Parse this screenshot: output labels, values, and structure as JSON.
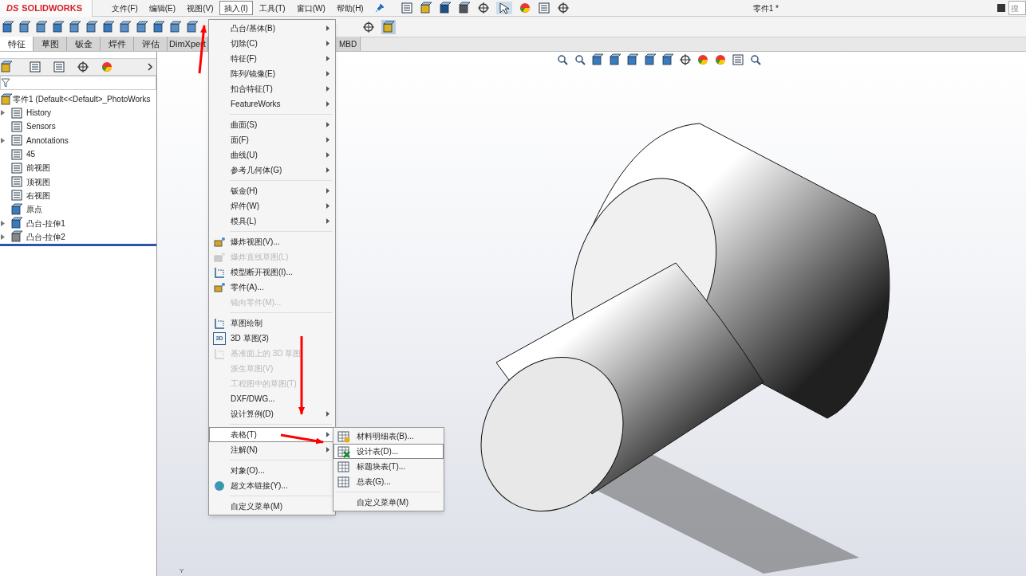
{
  "app": {
    "logo_text": "SOLIDWORKS",
    "logo_prefix": "DS"
  },
  "menu_bar": [
    {
      "label": "文件(F)",
      "selected": false
    },
    {
      "label": "编辑(E)",
      "selected": false
    },
    {
      "label": "视图(V)",
      "selected": false
    },
    {
      "label": "插入(I)",
      "selected": true
    },
    {
      "label": "工具(T)",
      "selected": false
    },
    {
      "label": "窗口(W)",
      "selected": false
    },
    {
      "label": "帮助(H)",
      "selected": false
    }
  ],
  "document_title": "零件1 *",
  "search": {
    "placeholder": "搜"
  },
  "command_tabs": [
    {
      "label": "特征",
      "selected": true
    },
    {
      "label": "草图",
      "selected": false
    },
    {
      "label": "钣金",
      "selected": false
    },
    {
      "label": "焊件",
      "selected": false
    },
    {
      "label": "评估",
      "selected": false
    },
    {
      "label": "DimXpert",
      "selected": false
    }
  ],
  "command_tab_tail": {
    "label": "MBD",
    "selected": false
  },
  "feature_tree": {
    "root": "零件1  (Default<<Default>_PhotoWorks",
    "items": [
      {
        "label": "History",
        "expandable": true
      },
      {
        "label": "Sensors",
        "expandable": false
      },
      {
        "label": "Annotations",
        "expandable": true
      },
      {
        "label": "45",
        "expandable": false
      },
      {
        "label": "前视图",
        "expandable": false
      },
      {
        "label": "顶视图",
        "expandable": false
      },
      {
        "label": "右视图",
        "expandable": false
      },
      {
        "label": "原点",
        "expandable": false
      },
      {
        "label": "凸台-拉伸1",
        "expandable": true
      },
      {
        "label": "凸台-拉伸2",
        "expandable": true
      }
    ]
  },
  "insert_menu": [
    {
      "kind": "item",
      "label": "凸台/基体(B)",
      "submenu": true,
      "disabled": false,
      "selected": false
    },
    {
      "kind": "item",
      "label": "切除(C)",
      "submenu": true,
      "disabled": false,
      "selected": false
    },
    {
      "kind": "item",
      "label": "特征(F)",
      "submenu": true,
      "disabled": false,
      "selected": false
    },
    {
      "kind": "item",
      "label": "阵列/镜像(E)",
      "submenu": true,
      "disabled": false,
      "selected": false
    },
    {
      "kind": "item",
      "label": "扣合特征(T)",
      "submenu": true,
      "disabled": false,
      "selected": false
    },
    {
      "kind": "item",
      "label": "FeatureWorks",
      "submenu": true,
      "disabled": false,
      "selected": false
    },
    {
      "kind": "separator"
    },
    {
      "kind": "item",
      "label": "曲面(S)",
      "submenu": true,
      "disabled": false,
      "selected": false
    },
    {
      "kind": "item",
      "label": "面(F)",
      "submenu": true,
      "disabled": false,
      "selected": false
    },
    {
      "kind": "item",
      "label": "曲线(U)",
      "submenu": true,
      "disabled": false,
      "selected": false
    },
    {
      "kind": "item",
      "label": "参考几何体(G)",
      "submenu": true,
      "disabled": false,
      "selected": false
    },
    {
      "kind": "separator"
    },
    {
      "kind": "item",
      "label": "钣金(H)",
      "submenu": true,
      "disabled": false,
      "selected": false
    },
    {
      "kind": "item",
      "label": "焊件(W)",
      "submenu": true,
      "disabled": false,
      "selected": false
    },
    {
      "kind": "item",
      "label": "模具(L)",
      "submenu": true,
      "disabled": false,
      "selected": false
    },
    {
      "kind": "separator"
    },
    {
      "kind": "item",
      "label": "爆炸视图(V)...",
      "submenu": false,
      "disabled": false,
      "selected": false
    },
    {
      "kind": "item",
      "label": "爆炸直线草图(L)",
      "submenu": false,
      "disabled": true,
      "selected": false
    },
    {
      "kind": "item",
      "label": "模型断开视图(I)...",
      "submenu": false,
      "disabled": false,
      "selected": false
    },
    {
      "kind": "item",
      "label": "零件(A)...",
      "submenu": false,
      "disabled": false,
      "selected": false
    },
    {
      "kind": "item",
      "label": "镜向零件(M)...",
      "submenu": false,
      "disabled": true,
      "selected": false
    },
    {
      "kind": "separator"
    },
    {
      "kind": "item",
      "label": "草图绘制",
      "submenu": false,
      "disabled": false,
      "selected": false
    },
    {
      "kind": "item",
      "label": "3D 草图(3)",
      "icon_label": "3D",
      "submenu": false,
      "disabled": false,
      "selected": false
    },
    {
      "kind": "item",
      "label": "基准面上的 3D 草图",
      "submenu": false,
      "disabled": true,
      "selected": false
    },
    {
      "kind": "item",
      "label": "派生草图(V)",
      "submenu": false,
      "disabled": true,
      "selected": false
    },
    {
      "kind": "item",
      "label": "工程图中的草图(T)",
      "submenu": false,
      "disabled": true,
      "selected": false
    },
    {
      "kind": "item",
      "label": "DXF/DWG...",
      "submenu": false,
      "disabled": false,
      "selected": false
    },
    {
      "kind": "item",
      "label": "设计算例(D)",
      "submenu": true,
      "disabled": false,
      "selected": false
    },
    {
      "kind": "separator"
    },
    {
      "kind": "item",
      "label": "表格(T)",
      "submenu": true,
      "disabled": false,
      "selected": true
    },
    {
      "kind": "item",
      "label": "注解(N)",
      "submenu": true,
      "disabled": false,
      "selected": false
    },
    {
      "kind": "separator"
    },
    {
      "kind": "item",
      "label": "对象(O)...",
      "submenu": false,
      "disabled": false,
      "selected": false
    },
    {
      "kind": "item",
      "label": "超文本链接(Y)...",
      "submenu": false,
      "disabled": false,
      "selected": false
    },
    {
      "kind": "separator"
    },
    {
      "kind": "item",
      "label": "自定义菜单(M)",
      "submenu": false,
      "disabled": false,
      "selected": false
    }
  ],
  "table_submenu": [
    {
      "kind": "item",
      "label": "材料明细表(B)...",
      "selected": false
    },
    {
      "kind": "item",
      "label": "设计表(D)...",
      "selected": true
    },
    {
      "kind": "item",
      "label": "标题块表(T)...",
      "selected": false
    },
    {
      "kind": "item",
      "label": "总表(G)...",
      "selected": false
    },
    {
      "kind": "separator"
    },
    {
      "kind": "item",
      "label": "自定义菜单(M)",
      "selected": false
    }
  ],
  "viewport": {
    "axis_label": "Y"
  }
}
